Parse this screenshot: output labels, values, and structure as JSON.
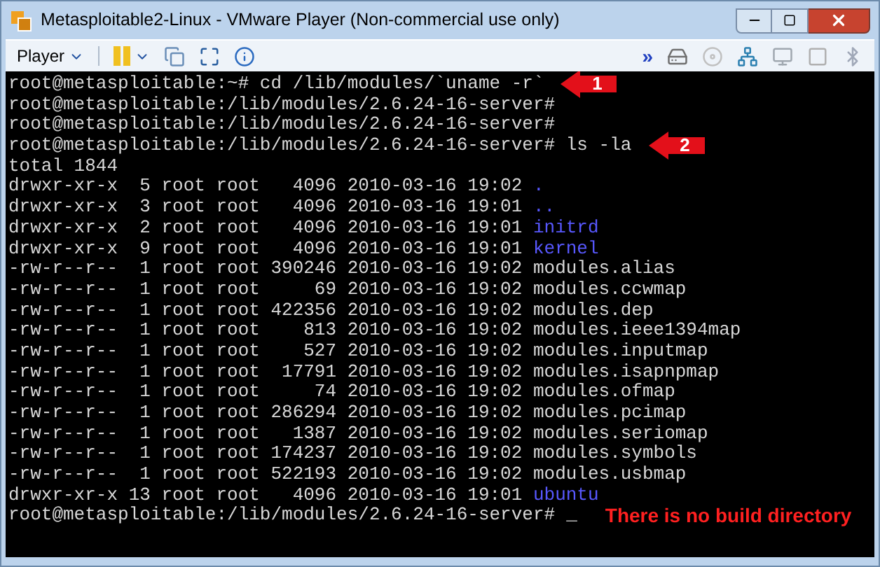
{
  "window": {
    "title": "Metasploitable2-Linux - VMware Player (Non-commercial use only)"
  },
  "toolbar": {
    "menu": "Player",
    "more": "»"
  },
  "terminal": {
    "lines": [
      {
        "kind": "prompt",
        "text": "root@metasploitable:~# cd /lib/modules/`uname -r`",
        "callout": "1"
      },
      {
        "kind": "prompt",
        "text": "root@metasploitable:/lib/modules/2.6.24-16-server#"
      },
      {
        "kind": "prompt",
        "text": "root@metasploitable:/lib/modules/2.6.24-16-server#"
      },
      {
        "kind": "prompt",
        "text": "root@metasploitable:/lib/modules/2.6.24-16-server# ls -la",
        "callout": "2"
      },
      {
        "kind": "text",
        "text": "total 1844"
      },
      {
        "kind": "dir",
        "text": "drwxr-xr-x  5 root root   4096 2010-03-16 19:02 ",
        "name": "."
      },
      {
        "kind": "dir",
        "text": "drwxr-xr-x  3 root root   4096 2010-03-16 19:01 ",
        "name": ".."
      },
      {
        "kind": "dir",
        "text": "drwxr-xr-x  2 root root   4096 2010-03-16 19:01 ",
        "name": "initrd"
      },
      {
        "kind": "dir",
        "text": "drwxr-xr-x  9 root root   4096 2010-03-16 19:01 ",
        "name": "kernel"
      },
      {
        "kind": "file",
        "text": "-rw-r--r--  1 root root 390246 2010-03-16 19:02 ",
        "name": "modules.alias"
      },
      {
        "kind": "file",
        "text": "-rw-r--r--  1 root root     69 2010-03-16 19:02 ",
        "name": "modules.ccwmap"
      },
      {
        "kind": "file",
        "text": "-rw-r--r--  1 root root 422356 2010-03-16 19:02 ",
        "name": "modules.dep"
      },
      {
        "kind": "file",
        "text": "-rw-r--r--  1 root root    813 2010-03-16 19:02 ",
        "name": "modules.ieee1394map"
      },
      {
        "kind": "file",
        "text": "-rw-r--r--  1 root root    527 2010-03-16 19:02 ",
        "name": "modules.inputmap"
      },
      {
        "kind": "file",
        "text": "-rw-r--r--  1 root root  17791 2010-03-16 19:02 ",
        "name": "modules.isapnpmap"
      },
      {
        "kind": "file",
        "text": "-rw-r--r--  1 root root     74 2010-03-16 19:02 ",
        "name": "modules.ofmap"
      },
      {
        "kind": "file",
        "text": "-rw-r--r--  1 root root 286294 2010-03-16 19:02 ",
        "name": "modules.pcimap"
      },
      {
        "kind": "file",
        "text": "-rw-r--r--  1 root root   1387 2010-03-16 19:02 ",
        "name": "modules.seriomap"
      },
      {
        "kind": "file",
        "text": "-rw-r--r--  1 root root 174237 2010-03-16 19:02 ",
        "name": "modules.symbols"
      },
      {
        "kind": "file",
        "text": "-rw-r--r--  1 root root 522193 2010-03-16 19:02 ",
        "name": "modules.usbmap"
      },
      {
        "kind": "dir",
        "text": "drwxr-xr-x 13 root root   4096 2010-03-16 19:01 ",
        "name": "ubuntu"
      },
      {
        "kind": "prompt",
        "text": "root@metasploitable:/lib/modules/2.6.24-16-server#",
        "cursor": "_",
        "note": "There is no build directory"
      }
    ]
  }
}
